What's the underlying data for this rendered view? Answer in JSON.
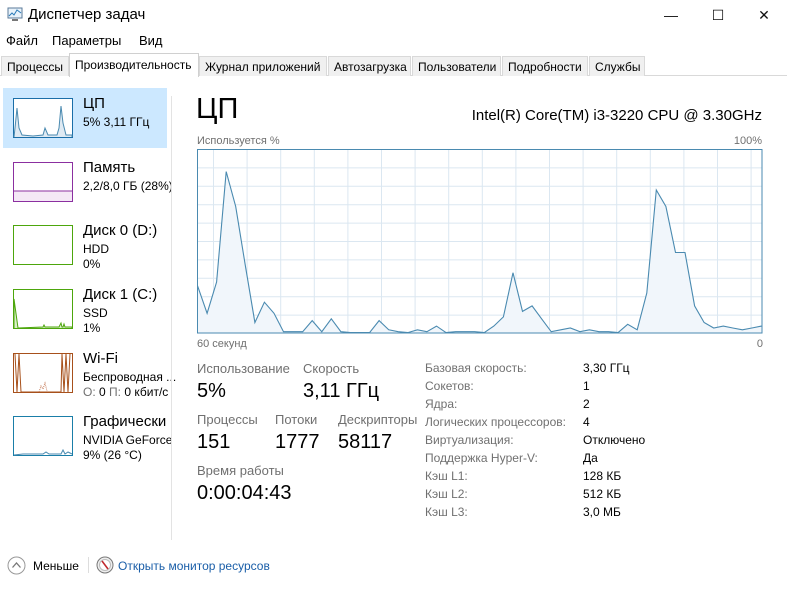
{
  "window": {
    "title": "Диспетчер задач",
    "minimize": "—",
    "maximize": "☐",
    "close": "✕"
  },
  "menu": [
    "Файл",
    "Параметры",
    "Вид"
  ],
  "tabs": [
    "Процессы",
    "Производительность",
    "Журнал приложений",
    "Автозагрузка",
    "Пользователи",
    "Подробности",
    "Службы"
  ],
  "sidebar": [
    {
      "name": "ЦП",
      "line1": "5%  3,11 ГГц",
      "color": "#1a6ea8"
    },
    {
      "name": "Память",
      "line1": "2,2/8,0 ГБ (28%)",
      "color": "#8b2fa0"
    },
    {
      "name": "Диск 0 (D:)",
      "line1": "HDD",
      "line2": "0%",
      "color": "#4da60c"
    },
    {
      "name": "Диск 1 (C:)",
      "line1": "SSD",
      "line2": "1%",
      "color": "#4da60c"
    },
    {
      "name": "Wi-Fi",
      "line1": "Беспроводная ...",
      "line2_o": "О:",
      "line2_ov": "0",
      "line2_p": "П:",
      "line2_pv": "0 кбит/с",
      "color": "#a7501b"
    },
    {
      "name": "Графически",
      "line1": "NVIDIA GeForce",
      "line2": "9%  (26 °C)",
      "color": "#1a7ea8"
    }
  ],
  "main": {
    "title": "ЦП",
    "cpu_name": "Intel(R) Core(TM) i3-3220 CPU @ 3.30GHz",
    "graph_label": "Используется %",
    "graph_max": "100%",
    "graph_left": "60 секунд",
    "graph_right": "0",
    "stats": {
      "usage_label": "Использование",
      "usage": "5%",
      "speed_label": "Скорость",
      "speed": "3,11 ГГц",
      "processes_label": "Процессы",
      "processes": "151",
      "threads_label": "Потоки",
      "threads": "1777",
      "handles_label": "Дескрипторы",
      "handles": "58117",
      "uptime_label": "Время работы",
      "uptime": "0:00:04:43"
    },
    "specs": [
      [
        "Базовая скорость:",
        "3,30 ГГц"
      ],
      [
        "Сокетов:",
        "1"
      ],
      [
        "Ядра:",
        "2"
      ],
      [
        "Логических процессоров:",
        "4"
      ],
      [
        "Виртуализация:",
        "Отключено"
      ],
      [
        "Поддержка Hyper-V:",
        "Да"
      ],
      [
        "Кэш L1:",
        "128 КБ"
      ],
      [
        "Кэш L2:",
        "512 КБ"
      ],
      [
        "Кэш L3:",
        "3,0 МБ"
      ]
    ]
  },
  "cpu_graph": {
    "type": "area",
    "ylim": [
      0,
      100
    ],
    "color": "#4a8ab0",
    "fill": "#f1f6fb",
    "values": [
      26,
      11,
      28,
      88,
      69,
      37,
      6,
      17,
      11,
      1,
      1,
      1,
      7,
      1,
      8,
      1,
      0.5,
      0.5,
      0.5,
      7,
      2,
      1,
      0.5,
      2,
      1,
      4,
      0.5,
      1,
      1,
      1,
      0.5,
      4,
      9,
      33,
      12,
      15,
      8,
      1,
      2,
      3,
      1,
      2,
      1,
      1,
      0.5,
      5,
      2,
      22,
      78,
      69,
      44,
      44,
      15,
      6,
      3,
      4,
      3,
      2,
      3,
      4
    ]
  },
  "footer": {
    "less": "Меньше",
    "monitor": "Открыть монитор ресурсов"
  }
}
